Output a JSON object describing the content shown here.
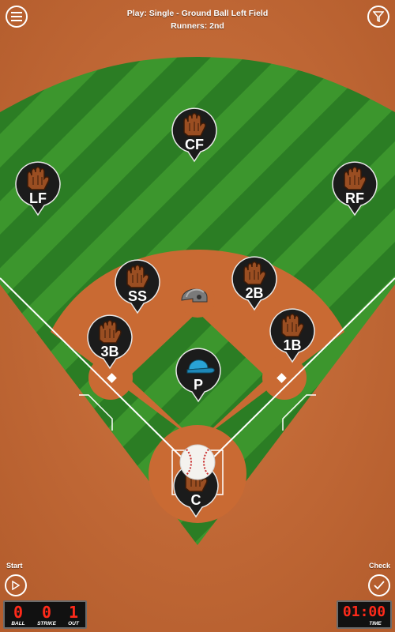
{
  "header": {
    "play_text": "Play: Single - Ground Ball Left Field",
    "runners_text": "Runners: 2nd"
  },
  "menu_button": {
    "icon": "hamburger-menu-icon"
  },
  "filter_button": {
    "icon": "funnel-filter-icon"
  },
  "start": {
    "label": "Start",
    "icon": "play-icon"
  },
  "check": {
    "label": "Check",
    "icon": "checkmark-icon"
  },
  "scoreboard": {
    "ball_value": "0",
    "ball_label": "BALL",
    "strike_value": "0",
    "strike_label": "STRIKE",
    "out_value": "1",
    "out_label": "OUT"
  },
  "timer": {
    "value": "01:00",
    "label": "TIME"
  },
  "positions": [
    {
      "id": "lf",
      "label": "LF",
      "icon": "baseball-glove-icon"
    },
    {
      "id": "cf",
      "label": "CF",
      "icon": "baseball-glove-icon"
    },
    {
      "id": "rf",
      "label": "RF",
      "icon": "baseball-glove-icon"
    },
    {
      "id": "ss",
      "label": "SS",
      "icon": "baseball-glove-icon"
    },
    {
      "id": "2b",
      "label": "2B",
      "icon": "baseball-glove-icon"
    },
    {
      "id": "3b",
      "label": "3B",
      "icon": "baseball-glove-icon"
    },
    {
      "id": "1b",
      "label": "1B",
      "icon": "baseball-glove-icon"
    },
    {
      "id": "p",
      "label": "P",
      "icon": "baseball-cap-icon"
    },
    {
      "id": "c",
      "label": "C",
      "icon": "baseball-glove-icon"
    }
  ],
  "runner_marker": {
    "icon": "batting-helmet-icon",
    "base": "2nd"
  },
  "ball": {
    "icon": "baseball-icon"
  },
  "colors": {
    "dirt": "#c46a34",
    "grass_light": "#3f9a2e",
    "grass_dark": "#2a7a22",
    "pin": "#1b1b1b",
    "led": "#ff2a1a"
  }
}
